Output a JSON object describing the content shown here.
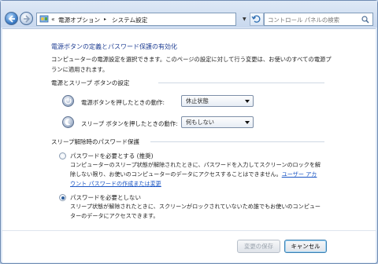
{
  "address": {
    "chevron": "«",
    "breadcrumb": [
      "電源オプション",
      "システム設定"
    ],
    "separator": "▸",
    "search_placeholder": "コントロール パネルの検索"
  },
  "main": {
    "title": "電源ボタンの定義とパスワード保護の有効化",
    "intro": "コンピューターの電源設定を選択できます。このページの設定に対して行う変更は、お使いのすべての電源プランに適用されます。",
    "buttons_group": {
      "label": "電源とスリープ ボタンの設定",
      "power": {
        "label": "電源ボタンを押したときの動作:",
        "value": "休止状態"
      },
      "sleep": {
        "label": "スリープ ボタンを押したときの動作:",
        "value": "何もしない"
      }
    },
    "password_group": {
      "label": "スリープ解除時のパスワード保護",
      "require": {
        "label": "パスワードを必要とする (推奨)",
        "desc": "コンピューターのスリープ状態が解除されたときに、パスワードを入力してスクリーンのロックを解除しない限り、お使いのコンピューターのデータにアクセスすることはできません。",
        "link": "ユーザー アカウント パスワードの作成または変更",
        "selected": false
      },
      "not_require": {
        "label": "パスワードを必要としない",
        "desc": "スリープ状態が解除されたときに、スクリーンがロックされていないため誰でもお使いのコンピューターのデータにアクセスできます。",
        "selected": true
      }
    }
  },
  "footer": {
    "save_label": "変更の保存",
    "cancel_label": "キャンセル"
  }
}
